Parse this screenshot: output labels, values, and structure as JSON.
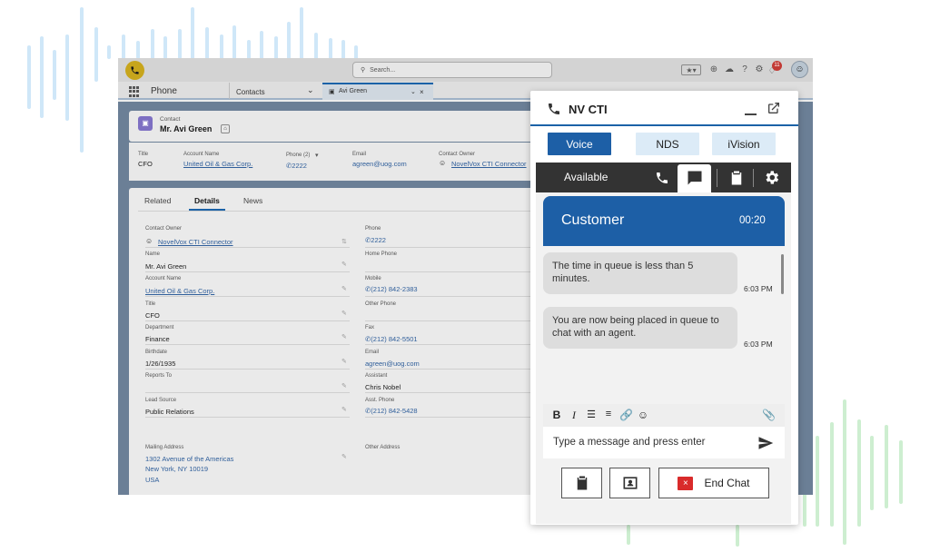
{
  "colors": {
    "accent_blue": "#1d5fa6",
    "tab_light": "#dcebf7",
    "status_dark": "#333333",
    "end_chat_red": "#d92b2b"
  },
  "salesforce": {
    "search_placeholder": "Search...",
    "notification_count": "11",
    "app_name": "Phone",
    "tabs": [
      {
        "label": "Contacts"
      },
      {
        "label": "Avi Green"
      }
    ],
    "record": {
      "object_label": "Contact",
      "name": "Mr. Avi Green",
      "highlights": [
        {
          "label": "Title",
          "value": "CFO"
        },
        {
          "label": "Account Name",
          "value": "United Oil & Gas Corp."
        },
        {
          "label": "Phone (2)",
          "value": "2222"
        },
        {
          "label": "Email",
          "value": "agreen@uog.com"
        },
        {
          "label": "Contact Owner",
          "value": "NovelVox CTI Connector"
        }
      ]
    },
    "detail_tabs": [
      "Related",
      "Details",
      "News"
    ],
    "fields_left": [
      {
        "label": "Contact Owner",
        "value": "NovelVox CTI Connector"
      },
      {
        "label": "Name",
        "value": "Mr. Avi Green"
      },
      {
        "label": "Account Name",
        "value": "United Oil & Gas Corp."
      },
      {
        "label": "Title",
        "value": "CFO"
      },
      {
        "label": "Department",
        "value": "Finance"
      },
      {
        "label": "Birthdate",
        "value": "1/26/1935"
      },
      {
        "label": "Reports To",
        "value": ""
      },
      {
        "label": "Lead Source",
        "value": "Public Relations"
      }
    ],
    "fields_right": [
      {
        "label": "Phone",
        "value": "2222"
      },
      {
        "label": "Home Phone",
        "value": ""
      },
      {
        "label": "Mobile",
        "value": "(212) 842-2383"
      },
      {
        "label": "Other Phone",
        "value": ""
      },
      {
        "label": "Fax",
        "value": "(212) 842-5501"
      },
      {
        "label": "Email",
        "value": "agreen@uog.com"
      },
      {
        "label": "Assistant",
        "value": "Chris Nobel"
      },
      {
        "label": "Asst. Phone",
        "value": "(212) 842-5428"
      }
    ],
    "mailing_address": {
      "label": "Mailing Address",
      "line1": "1302 Avenue of the Americas",
      "line2": "New York, NY 10019",
      "line3": "USA"
    },
    "other_address_label": "Other Address"
  },
  "cti": {
    "title": "NV CTI",
    "tabs": [
      "Voice",
      "NDS",
      "iVision"
    ],
    "status": "Available",
    "chat": {
      "header": "Customer",
      "timer": "00:20",
      "messages": [
        {
          "text": "The time in queue is less than 5 minutes.",
          "time": "6:03 PM"
        },
        {
          "text": "You are now being placed in queue to chat with an agent.",
          "time": "6:03 PM"
        }
      ],
      "compose_placeholder": "Type a message and press enter",
      "format_bold": "B",
      "format_italic": "I"
    },
    "end_chat_label": "End Chat"
  }
}
